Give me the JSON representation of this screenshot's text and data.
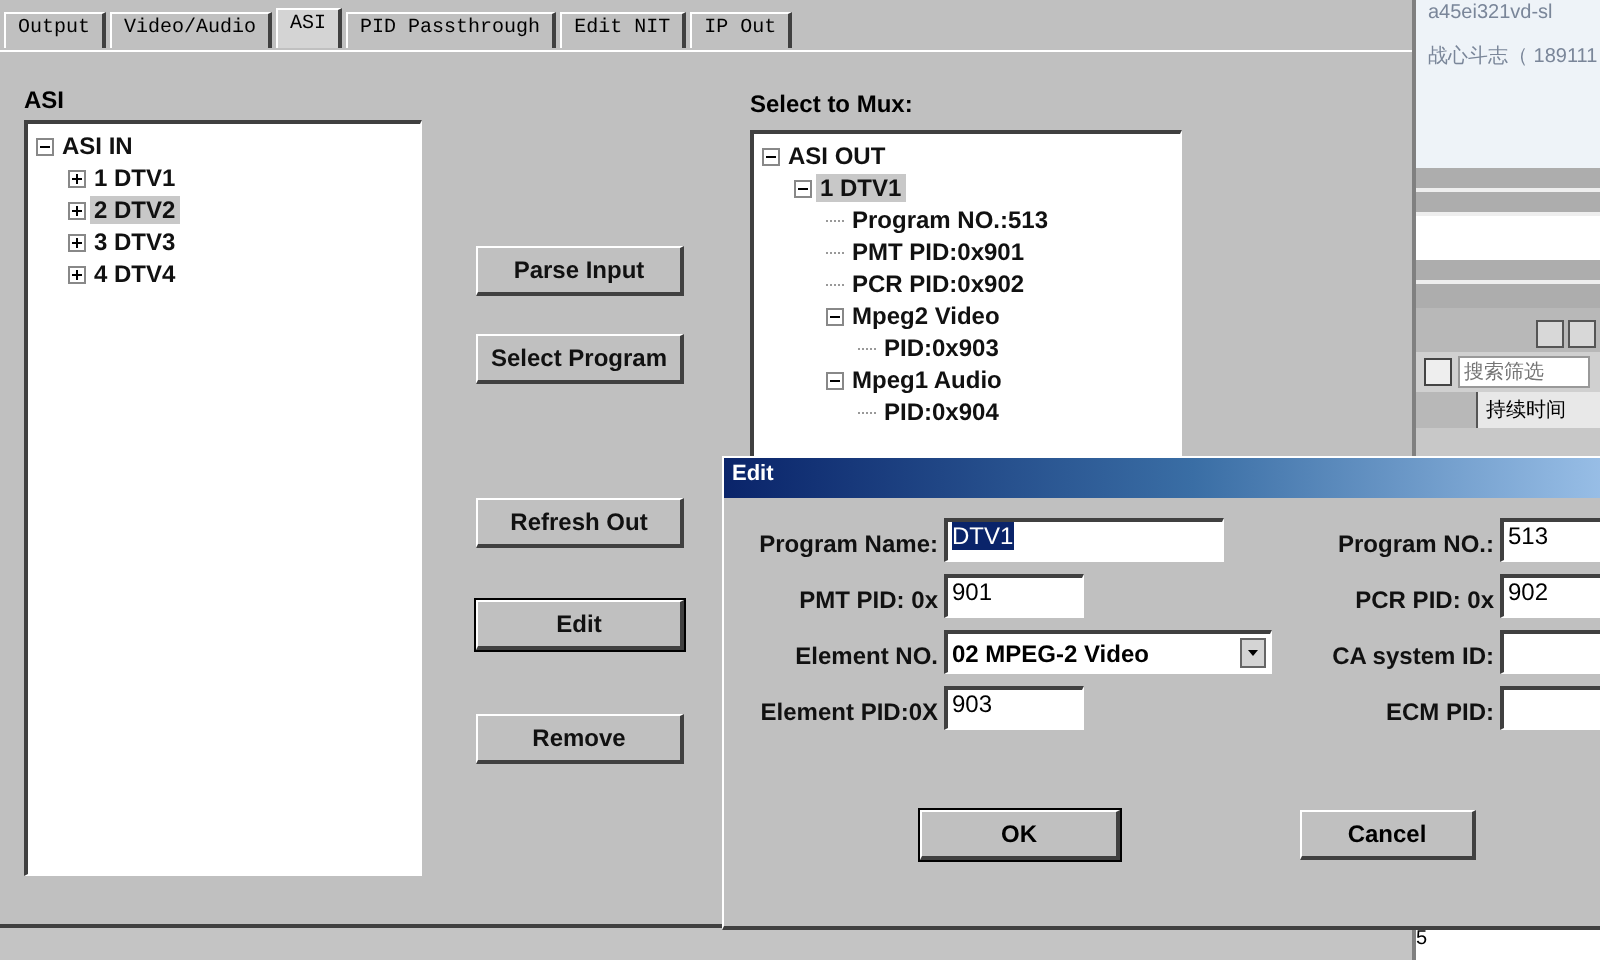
{
  "tabs": [
    {
      "label": "Output",
      "selected": false
    },
    {
      "label": "Video/Audio",
      "selected": false
    },
    {
      "label": "ASI",
      "selected": true
    },
    {
      "label": "PID Passthrough",
      "selected": false
    },
    {
      "label": "Edit NIT",
      "selected": false
    },
    {
      "label": "IP Out",
      "selected": false
    }
  ],
  "asi_panel": {
    "title": "ASI",
    "tree": [
      {
        "label": "ASI IN",
        "expanded": true,
        "selected": false,
        "children": [
          {
            "label": "1 DTV1",
            "expanded": false,
            "selected": false
          },
          {
            "label": "2 DTV2",
            "expanded": false,
            "selected": true
          },
          {
            "label": "3 DTV3",
            "expanded": false,
            "selected": false
          },
          {
            "label": "4 DTV4",
            "expanded": false,
            "selected": false
          }
        ]
      }
    ]
  },
  "buttons": [
    {
      "label": "Parse Input",
      "focused": false
    },
    {
      "label": "Select Program",
      "focused": false
    },
    {
      "label": "Refresh Out",
      "focused": false
    },
    {
      "label": "Edit",
      "focused": true
    },
    {
      "label": "Remove",
      "focused": false
    }
  ],
  "mux_panel": {
    "title": "Select to Mux:",
    "tree": [
      {
        "label": "ASI OUT",
        "expanded": true,
        "selected": false,
        "children": [
          {
            "label": "1 DTV1",
            "expanded": true,
            "selected": true,
            "children": [
              {
                "label": "Program NO.:513",
                "selected": false
              },
              {
                "label": "PMT PID:0x901",
                "selected": false
              },
              {
                "label": "PCR PID:0x902",
                "selected": false
              },
              {
                "label": "Mpeg2 Video",
                "expanded": true,
                "selected": false,
                "children": [
                  {
                    "label": "PID:0x903",
                    "selected": false
                  }
                ]
              },
              {
                "label": "Mpeg1 Audio",
                "expanded": true,
                "selected": false,
                "children": [
                  {
                    "label": "PID:0x904",
                    "selected": false
                  }
                ]
              }
            ]
          }
        ]
      }
    ]
  },
  "side_window": {
    "lines": [
      "a45ei321vd-sl",
      "战心斗志（ 189111"
    ],
    "search": {
      "placeholder": "搜索筛选"
    },
    "column_header": "持续时间",
    "row_number": "5"
  },
  "dialog": {
    "title": "Edit",
    "fields": [
      {
        "label": "Program Name:",
        "value": "DTV1",
        "kind": "long",
        "highlighted": true
      },
      {
        "label": "Program NO.:",
        "value": "513",
        "kind": "open",
        "highlighted": false
      },
      {
        "label": "PMT PID: 0x",
        "value": "901",
        "kind": "short",
        "highlighted": false
      },
      {
        "label": "PCR PID: 0x",
        "value": "902",
        "kind": "open",
        "highlighted": false
      },
      {
        "label": "Element NO.",
        "value": "02 MPEG-2 Video",
        "kind": "select"
      },
      {
        "label": "CA system ID:",
        "kind": "open"
      },
      {
        "label": "Element PID:0X",
        "value": "903",
        "kind": "short",
        "highlighted": false
      },
      {
        "label": "ECM PID:",
        "kind": "open"
      }
    ],
    "buttons": [
      {
        "label": "OK",
        "default": true
      },
      {
        "label": "Cancel",
        "default": false
      }
    ]
  }
}
